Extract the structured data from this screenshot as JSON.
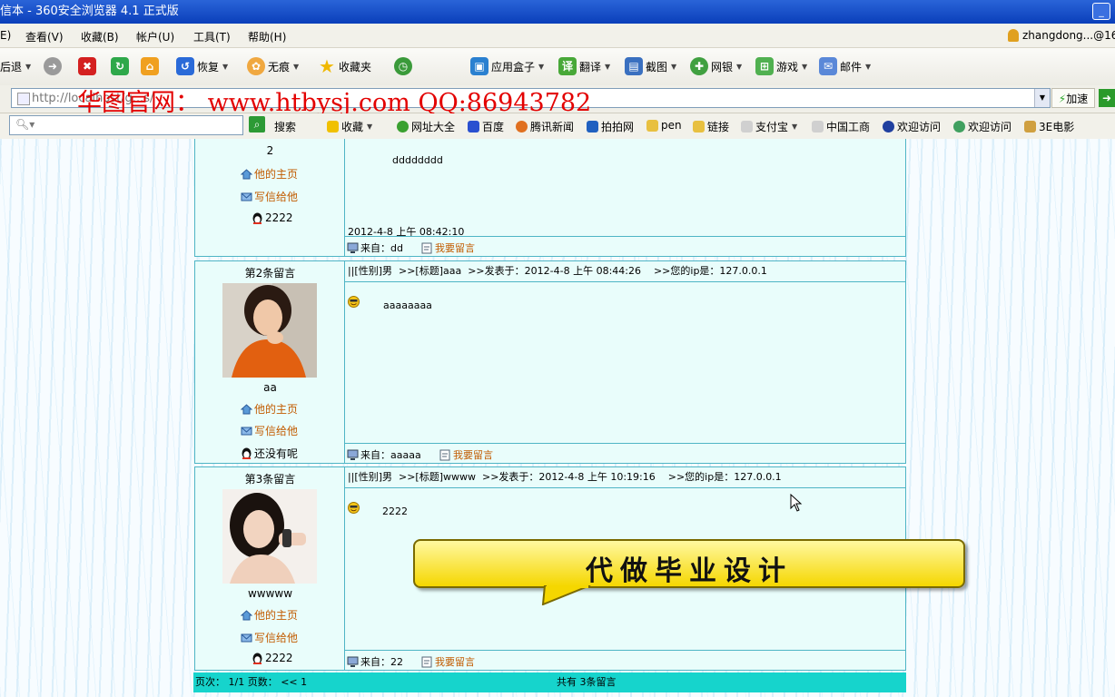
{
  "window": {
    "title": "信本 - 360安全浏览器 4.1 正式版"
  },
  "menu": {
    "items": [
      "E)",
      "查看(V)",
      "收藏(B)",
      "帐户(U)",
      "工具(T)",
      "帮助(H)"
    ],
    "user": "zhangdong...@16"
  },
  "toolbar": {
    "back": "后退",
    "restore": "恢复",
    "traceless": "无痕",
    "favorites": "收藏夹",
    "app_box": "应用盒子",
    "translate": "翻译",
    "screenshot": "截图",
    "netbank": "网银",
    "games": "游戏",
    "mail": "邮件"
  },
  "address": {
    "url": "http://localhost/g...s/",
    "speed": "加速"
  },
  "watermark": "华图官网： www.htbysj.com  QQ:86943782",
  "favbar": {
    "search_placeholder": "",
    "search_button": "搜索",
    "items": [
      "收藏",
      "网址大全",
      "百度",
      "腾讯新闻",
      "拍拍网",
      "pen",
      "链接",
      "支付宝",
      "中国工商",
      "欢迎访问",
      "欢迎访问",
      "3E电影"
    ]
  },
  "messages": [
    {
      "name": "2",
      "home_link": "他的主页",
      "mail_link": "写信给他",
      "qq": "2222",
      "body": "dddddddd",
      "posted": "2012-4-8 上午 08:42:10",
      "from": "来自：dd",
      "reply": "我要留言"
    },
    {
      "title": "第2条留言",
      "header": "||[性别]男  >>[标题]aaa  >>发表于：2012-4-8 上午 08:44:26    >>您的ip是：127.0.0.1",
      "name": "aa",
      "home_link": "他的主页",
      "mail_link": "写信给他",
      "qq": "还没有呢",
      "body": "aaaaaaaa",
      "from": "来自：aaaaa",
      "reply": "我要留言"
    },
    {
      "title": "第3条留言",
      "header": "||[性别]男  >>[标题]wwww  >>发表于：2012-4-8 上午 10:19:16    >>您的ip是：127.0.0.1",
      "name": "wwwww",
      "home_link": "他的主页",
      "mail_link": "写信给他",
      "qq": "2222",
      "body": "2222",
      "from": "来自：22",
      "reply": "我要留言"
    }
  ],
  "pager": {
    "left": "页次： 1/1 页数： << 1",
    "total": "共有 3条留言"
  },
  "overlay": {
    "banner": "代做毕业设计"
  },
  "colors": {
    "accent": "#16d4cc",
    "panel": "#e9fdfb",
    "border": "#4fb5c5",
    "link": "#c25b00",
    "watermark": "#e30000"
  }
}
